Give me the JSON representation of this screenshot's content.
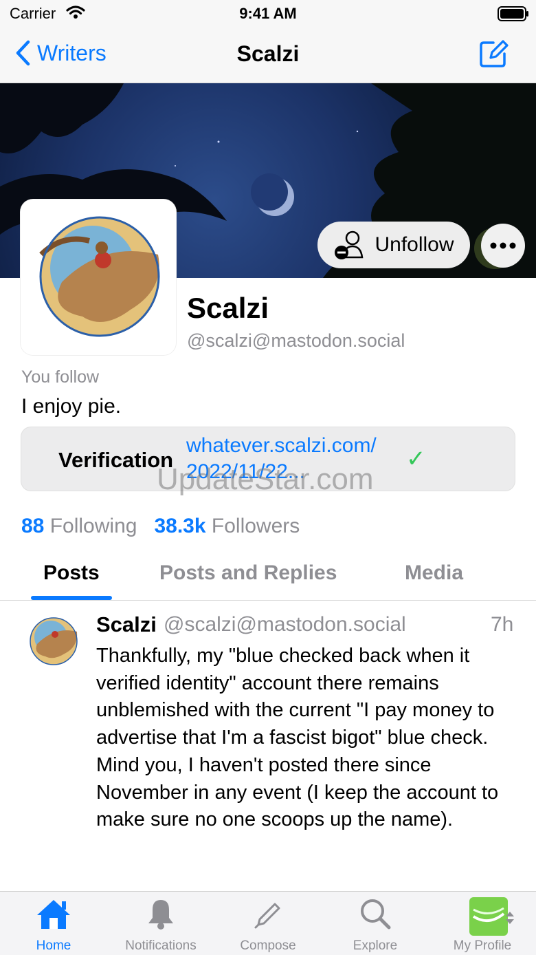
{
  "status_bar": {
    "carrier": "Carrier",
    "time": "9:41 AM"
  },
  "nav": {
    "back_label": "Writers",
    "title": "Scalzi"
  },
  "profile": {
    "unfollow_label": "Unfollow",
    "display_name": "Scalzi",
    "handle": "@scalzi@mastodon.social",
    "relationship": "You follow",
    "bio": "I enjoy pie.",
    "verification": {
      "label": "Verification",
      "link": "whatever.scalzi.com/ 2022/11/22...",
      "check": "✓"
    },
    "watermark": "UpdateStar.com",
    "stats": {
      "following_count": "88",
      "following_label": "Following",
      "followers_count": "38.3k",
      "followers_label": "Followers"
    }
  },
  "tabs": [
    "Posts",
    "Posts and Replies",
    "Media"
  ],
  "post": {
    "name": "Scalzi",
    "handle": "@scalzi@mastodon.social",
    "time": "7h",
    "body": "Thankfully, my \"blue checked back when it verified identity\" account there remains unblemished with the current \"I pay money to advertise that I'm a fascist bigot\" blue check. Mind you, I haven't posted there since November in any event (I keep the account to make sure no one scoops up the name)."
  },
  "tab_bar": [
    {
      "label": "Home",
      "icon": "home-icon"
    },
    {
      "label": "Notifications",
      "icon": "bell-icon"
    },
    {
      "label": "Compose",
      "icon": "pencil-icon"
    },
    {
      "label": "Explore",
      "icon": "magnifier-icon"
    },
    {
      "label": "My Profile",
      "icon": "profile-avatar-icon"
    }
  ],
  "colors": {
    "accent": "#0a7aff",
    "secondary_text": "#8e8e93",
    "check": "#34c759"
  }
}
